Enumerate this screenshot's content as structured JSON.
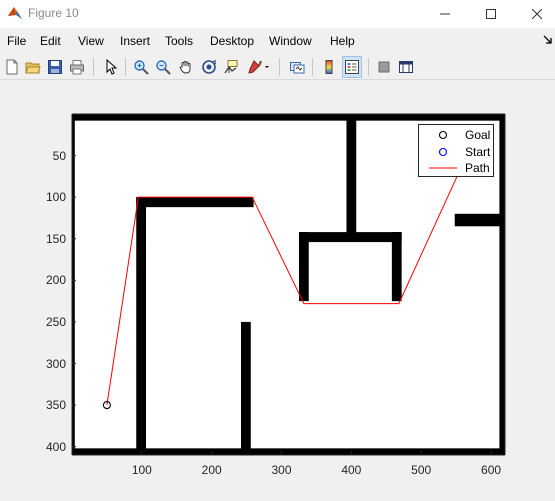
{
  "window": {
    "title": "Figure 10",
    "controls": [
      "minimize",
      "maximize",
      "close"
    ]
  },
  "menu": {
    "items": [
      "File",
      "Edit",
      "View",
      "Insert",
      "Tools",
      "Desktop",
      "Window",
      "Help"
    ]
  },
  "toolbar": {
    "buttons": [
      "new-figure",
      "open-file",
      "save",
      "print",
      "edit-plot",
      "zoom-in",
      "zoom-out",
      "pan",
      "rotate-3d",
      "data-cursor",
      "brush",
      "link-plot",
      "insert-colorbar",
      "insert-legend",
      "hide-plot-tools",
      "show-plot-tools"
    ]
  },
  "chart_data": {
    "type": "line",
    "title": "",
    "xlabel": "",
    "ylabel": "",
    "xlim": [
      0,
      620
    ],
    "ylim": [
      0,
      410
    ],
    "y_reversed": true,
    "xticks": [
      "100",
      "200",
      "300",
      "400",
      "500",
      "600"
    ],
    "xtick_values": [
      100,
      200,
      300,
      400,
      500,
      600
    ],
    "yticks": [
      "50",
      "100",
      "150",
      "200",
      "250",
      "300",
      "350",
      "400"
    ],
    "ytick_values": [
      50,
      100,
      150,
      200,
      250,
      300,
      350,
      400
    ],
    "legend": {
      "location": "top-right",
      "entries": [
        "Goal",
        "Start",
        "Path"
      ]
    },
    "series": [
      {
        "name": "Goal",
        "marker": "circle",
        "color": "#000000",
        "x": [
          50
        ],
        "y": [
          350
        ]
      },
      {
        "name": "Start",
        "marker": "circle",
        "color": "#0000ff",
        "x": [],
        "y": []
      },
      {
        "name": "Path",
        "color": "#ff0000",
        "x": [
          50,
          95,
          258,
          332,
          468,
          565
        ],
        "y": [
          350,
          100,
          100,
          228,
          228,
          50
        ]
      }
    ],
    "obstacles": [
      {
        "x": [
          0,
          620
        ],
        "y": [
          0,
          8
        ]
      },
      {
        "x": [
          0,
          620
        ],
        "y": [
          402,
          410
        ]
      },
      {
        "x": [
          612,
          620
        ],
        "y": [
          0,
          410
        ]
      },
      {
        "x": [
          0,
          4
        ],
        "y": [
          0,
          410
        ]
      },
      {
        "x": [
          92,
          260
        ],
        "y": [
          100,
          112
        ]
      },
      {
        "x": [
          92,
          106
        ],
        "y": [
          100,
          410
        ]
      },
      {
        "x": [
          242,
          256
        ],
        "y": [
          250,
          410
        ]
      },
      {
        "x": [
          393,
          407
        ],
        "y": [
          0,
          150
        ]
      },
      {
        "x": [
          325,
          472
        ],
        "y": [
          142,
          154
        ]
      },
      {
        "x": [
          325,
          339
        ],
        "y": [
          142,
          225
        ]
      },
      {
        "x": [
          458,
          472
        ],
        "y": [
          142,
          225
        ]
      },
      {
        "x": [
          548,
          620
        ],
        "y": [
          120,
          135
        ]
      }
    ]
  }
}
